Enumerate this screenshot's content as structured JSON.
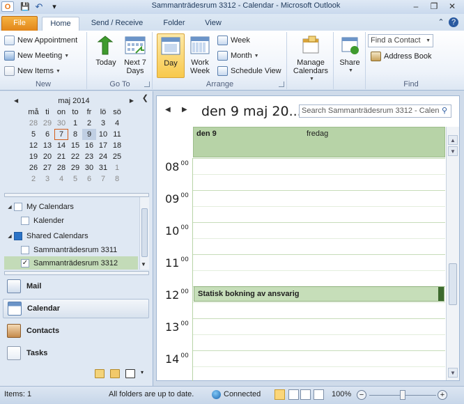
{
  "window": {
    "title": "Sammanträdesrum 3312 - Calendar - Microsoft Outlook",
    "minimize": "–",
    "restore": "❐",
    "close": "✕"
  },
  "quick_access": {
    "save": "💾",
    "undo": "↶",
    "customize": "▾"
  },
  "tabs": [
    {
      "label": "File"
    },
    {
      "label": "Home"
    },
    {
      "label": "Send / Receive"
    },
    {
      "label": "Folder"
    },
    {
      "label": "View"
    }
  ],
  "ribbon": {
    "new": {
      "label": "New",
      "new_appointment": "New Appointment",
      "new_meeting": "New Meeting",
      "new_items": "New Items"
    },
    "goto": {
      "label": "Go To",
      "today": "Today",
      "next7_l1": "Next 7",
      "next7_l2": "Days"
    },
    "arrange": {
      "label": "Arrange",
      "day": "Day",
      "work_week_l1": "Work",
      "work_week_l2": "Week",
      "week": "Week",
      "month": "Month",
      "schedule_view": "Schedule View"
    },
    "manage": {
      "label_l1": "Manage",
      "label_l2": "Calendars"
    },
    "share": {
      "label": "Share"
    },
    "find": {
      "label": "Find",
      "find_contact_placeholder": "Find a Contact",
      "address_book": "Address Book"
    }
  },
  "mini_calendar": {
    "month_label": "maj 2014",
    "weekdays": [
      "må",
      "ti",
      "on",
      "to",
      "fr",
      "lö",
      "sö"
    ],
    "weeks": [
      [
        "28",
        "29",
        "30",
        "1",
        "2",
        "3",
        "4"
      ],
      [
        "5",
        "6",
        "7",
        "8",
        "9",
        "10",
        "11"
      ],
      [
        "12",
        "13",
        "14",
        "15",
        "16",
        "17",
        "18"
      ],
      [
        "19",
        "20",
        "21",
        "22",
        "23",
        "24",
        "25"
      ],
      [
        "26",
        "27",
        "28",
        "29",
        "30",
        "31",
        "1"
      ],
      [
        "2",
        "3",
        "4",
        "5",
        "6",
        "7",
        "8"
      ]
    ],
    "today": "7",
    "selected": "9"
  },
  "folders": {
    "my_calendars": "My Calendars",
    "kalender": "Kalender",
    "shared_calendars": "Shared Calendars",
    "room_3311": "Sammanträdesrum 3311",
    "room_3312": "Sammanträdesrum 3312"
  },
  "nav_buttons": {
    "mail": "Mail",
    "calendar": "Calendar",
    "contacts": "Contacts",
    "tasks": "Tasks"
  },
  "calendar": {
    "date_heading": "den 9 maj 20...",
    "search_placeholder": "Search Sammanträdesrum 3312 - Calen",
    "day_date": "den 9",
    "day_name": "fredag",
    "hours": [
      {
        "h": "08",
        "m": "00"
      },
      {
        "h": "09",
        "m": "00"
      },
      {
        "h": "10",
        "m": "00"
      },
      {
        "h": "11",
        "m": "00"
      },
      {
        "h": "12",
        "m": "00"
      },
      {
        "h": "13",
        "m": "00"
      },
      {
        "h": "14",
        "m": "00"
      }
    ],
    "appointment": {
      "title": "Statisk bokning av ansvarig",
      "start_hour": "12"
    }
  },
  "status": {
    "items": "Items: 1",
    "sync": "All folders are up to date.",
    "connection": "Connected",
    "zoom": "100%",
    "zoom_level": 100
  },
  "colors": {
    "accent_file_tab": "#e2861a",
    "calendar_green": "#b7d3a7",
    "appointment_bar": "#3d6a2e"
  }
}
